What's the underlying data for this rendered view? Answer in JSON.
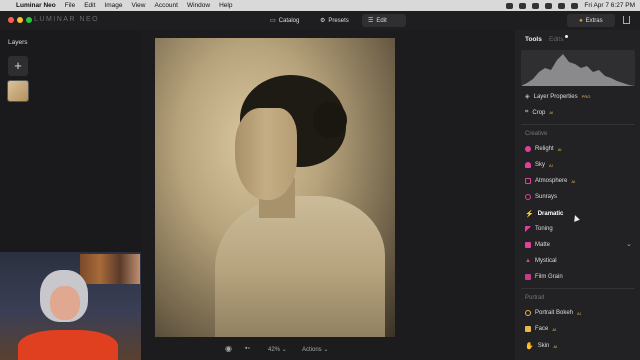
{
  "menubar": {
    "app_name": "Luminar Neo",
    "items": [
      "File",
      "Edit",
      "Image",
      "View",
      "Account",
      "Window",
      "Help"
    ],
    "datetime": "Fri Apr 7  6:27 PM"
  },
  "titlebar": {
    "logo": "LUMINAR NEO",
    "nav": {
      "catalog": "Catalog",
      "presets": "Presets",
      "edit": "Edit"
    },
    "extras": "Extras"
  },
  "left_panel": {
    "title": "Layers",
    "add_symbol": "+"
  },
  "bottom_bar": {
    "zoom": "42%",
    "actions": "Actions"
  },
  "right_panel": {
    "tabs": {
      "tools": "Tools",
      "edits": "Edits"
    },
    "essentials": [
      {
        "label": "Layer Properties",
        "tag": "PRO",
        "icon": "layers-icon",
        "color": "#bfbfbf"
      },
      {
        "label": "Crop",
        "tag": "AI",
        "icon": "crop-icon",
        "color": "#bfbfbf"
      }
    ],
    "creative_title": "Creative",
    "creative": [
      {
        "label": "Relight",
        "tag": "AI",
        "icon": "relight-icon",
        "color": "#e0409a"
      },
      {
        "label": "Sky",
        "tag": "AI",
        "icon": "cloud-icon",
        "color": "#e0409a"
      },
      {
        "label": "Atmosphere",
        "tag": "AI",
        "icon": "atmosphere-icon",
        "color": "#e0409a"
      },
      {
        "label": "Sunrays",
        "tag": "",
        "icon": "sunrays-icon",
        "color": "#e0409a"
      },
      {
        "label": "Dramatic",
        "tag": "",
        "icon": "dramatic-icon",
        "color": "#e0409a"
      },
      {
        "label": "Toning",
        "tag": "",
        "icon": "toning-icon",
        "color": "#e0409a"
      },
      {
        "label": "Matte",
        "tag": "",
        "icon": "matte-icon",
        "color": "#e0409a"
      },
      {
        "label": "Mystical",
        "tag": "",
        "icon": "mystical-icon",
        "color": "#e0409a"
      },
      {
        "label": "Film Grain",
        "tag": "",
        "icon": "film-grain-icon",
        "color": "#e0409a"
      }
    ],
    "portrait_title": "Portrait",
    "portrait": [
      {
        "label": "Portrait Bokeh",
        "tag": "AI",
        "icon": "portrait-bokeh-icon",
        "color": "#e7b84b"
      },
      {
        "label": "Face",
        "tag": "AI",
        "icon": "face-icon",
        "color": "#e7b84b"
      },
      {
        "label": "Skin",
        "tag": "AI",
        "icon": "skin-icon",
        "color": "#e7b84b"
      }
    ]
  }
}
